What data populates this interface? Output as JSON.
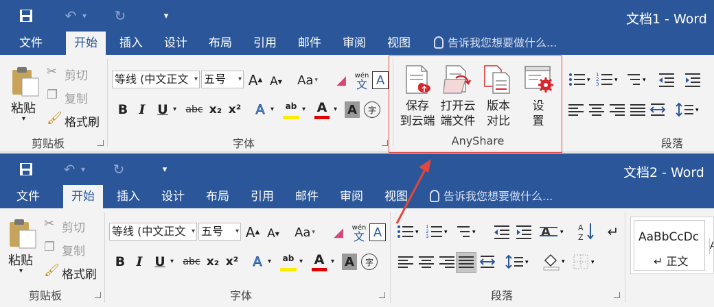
{
  "windows": [
    {
      "title": "文档1 - Word",
      "tabs": [
        "文件",
        "开始",
        "插入",
        "设计",
        "布局",
        "引用",
        "邮件",
        "审阅",
        "视图"
      ],
      "active_tab": "开始",
      "tell_me": "告诉我您想要做什么...",
      "clipboard": {
        "paste": "粘贴",
        "cut": "剪切",
        "copy": "复制",
        "format_painter": "格式刷",
        "group": "剪贴板"
      },
      "font": {
        "family": "等线 (中文正文",
        "size": "五号",
        "aa": "Aa",
        "group": "字体"
      },
      "anyshare": {
        "save_cloud": [
          "保存",
          "到云端"
        ],
        "open_cloud": [
          "打开云",
          "端文件"
        ],
        "version": [
          "版本",
          "对比"
        ],
        "settings": [
          "设",
          "置"
        ],
        "group": "AnyShare"
      },
      "paragraph": {
        "group": "段落"
      }
    },
    {
      "title": "文档2 - Word",
      "tabs": [
        "文件",
        "开始",
        "插入",
        "设计",
        "布局",
        "引用",
        "邮件",
        "审阅",
        "视图"
      ],
      "active_tab": "开始",
      "tell_me": "告诉我您想要做什么...",
      "clipboard": {
        "paste": "粘贴",
        "cut": "剪切",
        "copy": "复制",
        "format_painter": "格式刷",
        "group": "剪贴板"
      },
      "font": {
        "family": "等线 (中文正文",
        "size": "五号",
        "aa": "Aa",
        "group": "字体"
      },
      "paragraph": {
        "group": "段落"
      },
      "styles": {
        "preview": "AaBbCcDc",
        "normal": "正文"
      }
    }
  ],
  "glyphs": {
    "bold": "B",
    "italic": "I",
    "underline": "U",
    "strike": "abc",
    "subscript": "x₂",
    "superscript": "x²",
    "A": "A",
    "wen": "wén",
    "wenchar": "文",
    "encircle": "字",
    "undo": "↶",
    "redo": "↻",
    "save": "▪",
    "qat_more": "▾"
  },
  "colors": {
    "titlebar": "#2b579a",
    "ribbon": "#f3f3f3",
    "highlight_yellow": "#ffeb00",
    "font_red": "#e00000",
    "annotation_red": "#e2473e",
    "anyshare_red": "#d9262c"
  }
}
